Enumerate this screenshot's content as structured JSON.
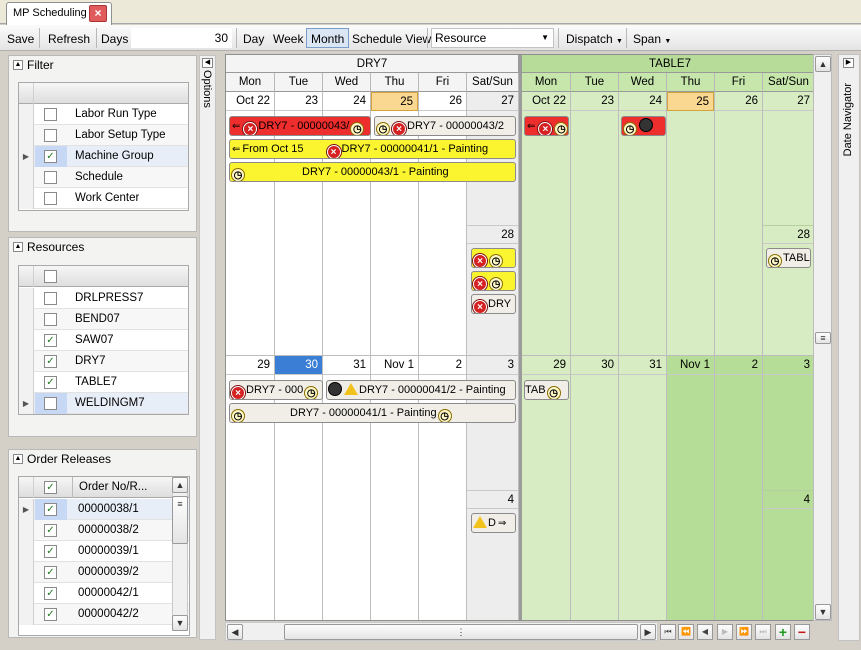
{
  "app": {
    "tab_title": "MP Scheduling",
    "tab_close": "×"
  },
  "toolbar": {
    "save": "Save",
    "refresh": "Refresh",
    "days_label": "Days",
    "days_value": "30",
    "day": "Day",
    "week": "Week",
    "month": "Month",
    "schedule_view": "Schedule View",
    "view_select": "Resource",
    "dispatch": "Dispatch",
    "span": "Span"
  },
  "options_label": "Options",
  "date_navigator_label": "Date Navigator",
  "filter": {
    "title": "Filter",
    "rows": [
      {
        "label": "Labor Run Type",
        "checked": false,
        "current": false
      },
      {
        "label": "Labor Setup Type",
        "checked": false,
        "current": false
      },
      {
        "label": "Machine Group",
        "checked": true,
        "current": true
      },
      {
        "label": "Schedule",
        "checked": false,
        "current": false
      },
      {
        "label": "Work Center",
        "checked": false,
        "current": false
      }
    ]
  },
  "resources": {
    "title": "Resources",
    "rows": [
      {
        "label": "DRLPRESS7",
        "checked": false,
        "current": false
      },
      {
        "label": "BEND07",
        "checked": false,
        "current": false
      },
      {
        "label": "SAW07",
        "checked": true,
        "current": false
      },
      {
        "label": "DRY7",
        "checked": true,
        "current": false
      },
      {
        "label": "TABLE7",
        "checked": true,
        "current": false
      },
      {
        "label": "WELDINGM7",
        "checked": false,
        "current": true
      }
    ]
  },
  "orders": {
    "title": "Order Releases",
    "column": "Order No/R...",
    "rows": [
      {
        "label": "00000038/1",
        "checked": true,
        "current": true
      },
      {
        "label": "00000038/2",
        "checked": true,
        "current": false
      },
      {
        "label": "00000039/1",
        "checked": true,
        "current": false
      },
      {
        "label": "00000039/2",
        "checked": true,
        "current": false
      },
      {
        "label": "00000042/1",
        "checked": true,
        "current": false
      },
      {
        "label": "00000042/2",
        "checked": true,
        "current": false
      }
    ]
  },
  "calendar": {
    "groups": [
      "DRY7",
      "TABLE7"
    ],
    "day_headers": [
      "Mon",
      "Tue",
      "Wed",
      "Thu",
      "Fri",
      "Sat/Sun"
    ],
    "week1": [
      "Oct 22",
      "23",
      "24",
      "25",
      "26",
      "27"
    ],
    "week1_sun": "28",
    "week2": [
      "29",
      "30",
      "31",
      "Nov 1",
      "2",
      "3"
    ],
    "week2_sun": "4",
    "events": {
      "e1": "DRY7 - 00000043/",
      "e2": "DRY7 - 00000043/2",
      "e3_from": "From Oct 15",
      "e3": "DRY7 - 00000041/1 - Painting",
      "e4": "DRY7 - 00000043/1 - Painting",
      "e5": "DRY",
      "e6": "DRY7 - 000",
      "e7": "DRY7 - 00000041/2 - Painting",
      "e8": "DRY7 - 00000041/1 - Painting",
      "e9": "D",
      "t1": "TABL",
      "t2": "TAB"
    }
  },
  "colors": {
    "today_header": "#fbd892",
    "selected_day": "#3a7fd5",
    "table7_bg": "#d7ecc2",
    "table7_header": "#b7dc9a",
    "event_red": "#ee2d2d",
    "event_yellow": "#fbf52f"
  }
}
